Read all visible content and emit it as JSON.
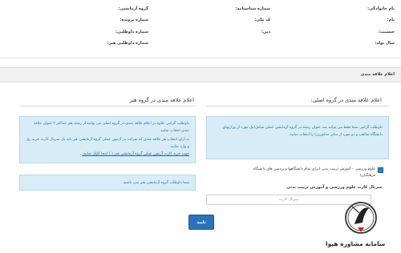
{
  "profile": {
    "row1": {
      "family": "نام خانوادگی:",
      "id_number": "شماره شناسنامه:",
      "group": "گروه آزمایشی:"
    },
    "row2": {
      "first_name": "نام:",
      "national_code": "کد ملی:",
      "file_number": "شماره پرونده:"
    },
    "row3": {
      "gender": "جنسیت:",
      "religion": "دین:",
      "applicant_number": "شماره داوطلبی:"
    },
    "row4": {
      "birth_year": "سال تولد:",
      "art_applicant_number": "شماره داوطلبی هنر:"
    }
  },
  "section": {
    "title": "اعلام علاقه مندی"
  },
  "right_col": {
    "title": "اعلام علاقه مندی در گروه اصلی:",
    "info_text": "داوطلب گرامی شما فقط می توانید سه عنوان رشته در گروه آزمایشی اصلی شامل(یک مورد از وزارتهای دانشگاه مذاهب و دو مورد از سایر مذکورین) را انتخاب نمایید.",
    "checkbox_label": "علوم ورزشی – آموزش تربیت بدنی (برای تمام دانشگاهها و پردیس های دانشگاه فرهنگیان)",
    "field_label": "سربال کارت علوم ورزشی و آموزش تربیت بدنی",
    "field_placeholder": "سریال کارت"
  },
  "left_col": {
    "title": "اعلام علاقه مندی در گروه هنر",
    "info_line1": "داوطلب گرامی علاوه بر اعلام علاقه مندی در گروه اصلی می توانید از رشته هنر حداکثر ۲ عنوان علاقه مندی انتخاب نمایید.",
    "info_line2": "به ازای انتخاب هر علاقه مندی که شرکت در آزمون عملی گروه آزمایشی هنر باید یک سریال کارت خرید ری و وارد نمایید.",
    "info_link": "جهت خرید کارت آزمون عملی گروه آزمایشی هنر ( ) اینجا کلیک نمایید.",
    "notice": "شما داوطلب گروه آزمایشی هنر نمی باشید."
  },
  "actions": {
    "submit_label": "تایید"
  },
  "logo": {
    "text": "سامانه مشاوره هپوا"
  }
}
